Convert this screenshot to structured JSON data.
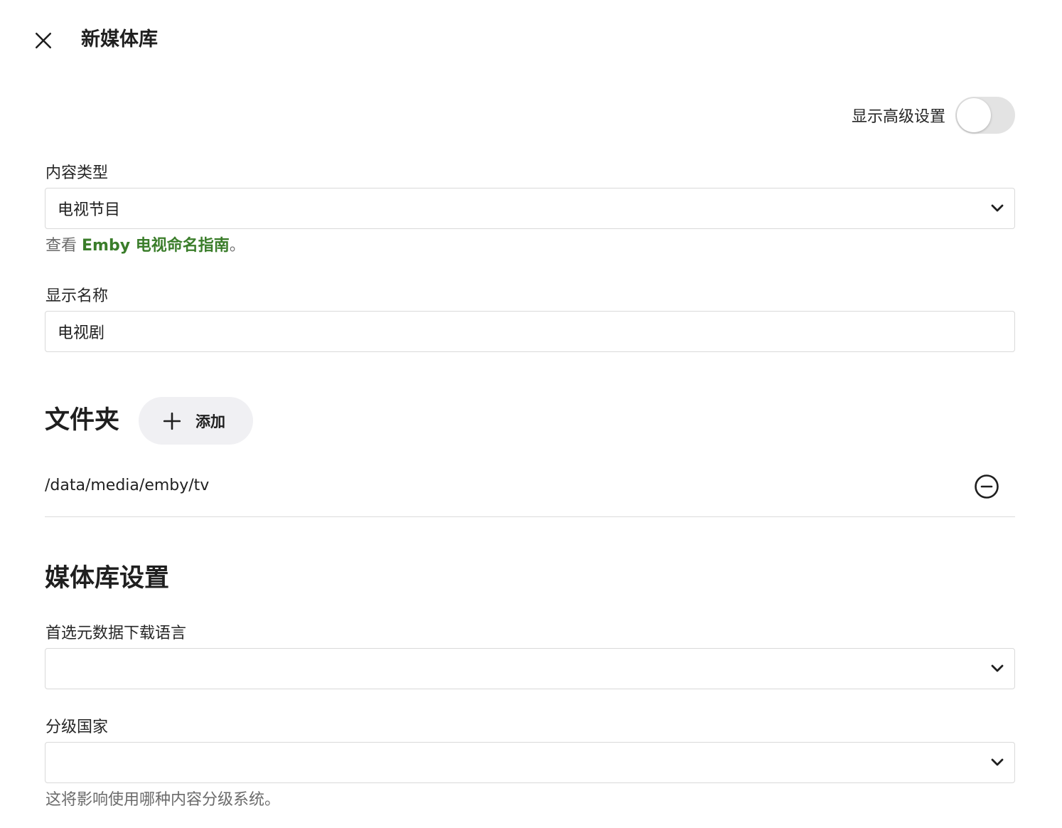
{
  "dialog": {
    "title": "新媒体库",
    "close_icon": "close-icon"
  },
  "advanced": {
    "label": "显示高级设置",
    "enabled": false
  },
  "content_type": {
    "label": "内容类型",
    "value": "电视节目",
    "helper_prefix": "查看 ",
    "helper_link": "Emby 电视命名指南",
    "helper_suffix": "。"
  },
  "display_name": {
    "label": "显示名称",
    "value": "电视剧"
  },
  "folders": {
    "title": "文件夹",
    "add_label": "添加",
    "items": [
      {
        "path": "/data/media/emby/tv"
      }
    ]
  },
  "library_settings": {
    "title": "媒体库设置",
    "metadata_language": {
      "label": "首选元数据下载语言",
      "value": ""
    },
    "rating_country": {
      "label": "分级国家",
      "value": "",
      "helper": "这将影响使用哪种内容分级系统。"
    }
  },
  "colors": {
    "link": "#3a7d2a",
    "toggle_off": "#e3e3e3",
    "border": "#d9d9d9"
  }
}
